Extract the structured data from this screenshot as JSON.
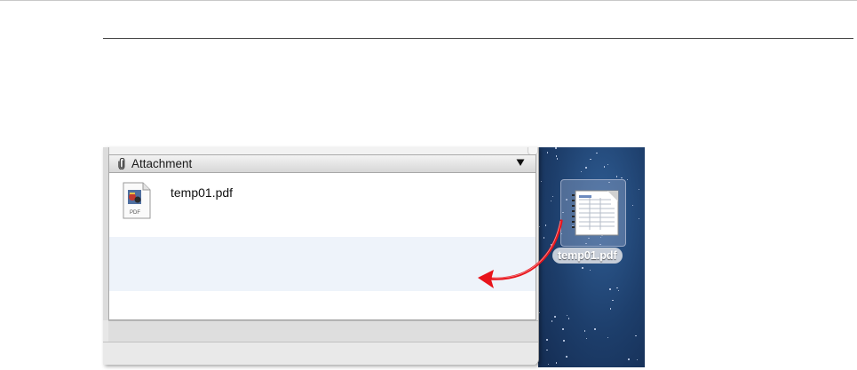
{
  "attachment_panel": {
    "header_label": "Attachment",
    "collapse_glyph": "▼",
    "icon": "paperclip-icon",
    "files": [
      {
        "name": "temp01.pdf",
        "icon": "pdf-file-icon",
        "icon_caption": "PDF"
      }
    ]
  },
  "desktop": {
    "file": {
      "name": "temp01.pdf",
      "icon": "pdf-thumbnail-icon"
    },
    "drag_arrow": {
      "icon": "drag-arrow-icon",
      "color": "#e8141b"
    }
  },
  "colors": {
    "panel_header": "#dddddd",
    "selection_row": "#eef3fa",
    "desktop_sky": "#1d3e6b",
    "arrow": "#e8141b"
  }
}
